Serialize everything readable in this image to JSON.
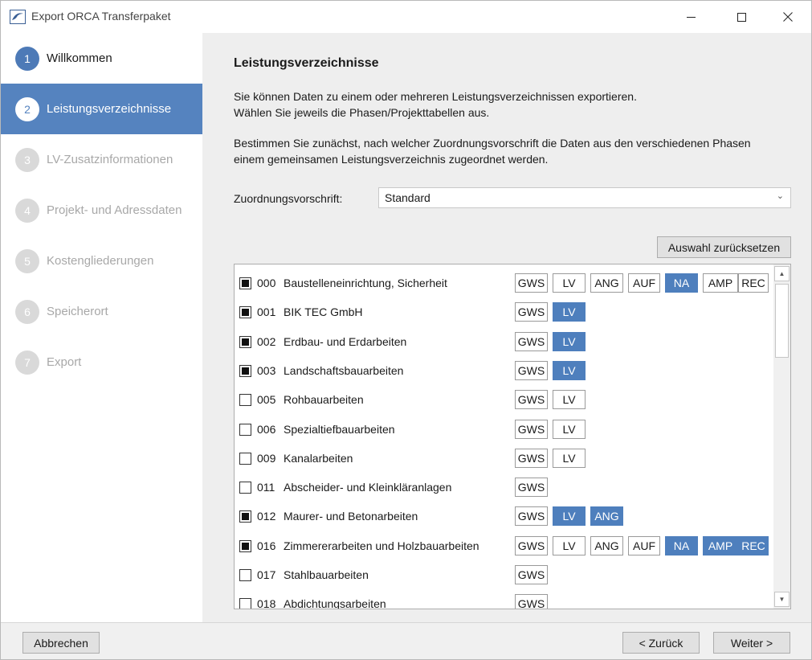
{
  "window": {
    "title": "Export ORCA Transferpaket",
    "icons": [
      "app-logo-icon",
      "minimize-icon",
      "maximize-icon",
      "close-icon"
    ]
  },
  "sidebar": {
    "steps": [
      {
        "num": "1",
        "label": "Willkommen",
        "state": "done"
      },
      {
        "num": "2",
        "label": "Leistungsverzeichnisse",
        "state": "active"
      },
      {
        "num": "3",
        "label": "LV-Zusatzinformationen",
        "state": "todo"
      },
      {
        "num": "4",
        "label": "Projekt- und Adressdaten",
        "state": "todo"
      },
      {
        "num": "5",
        "label": "Kostengliederungen",
        "state": "todo"
      },
      {
        "num": "6",
        "label": "Speicherort",
        "state": "todo"
      },
      {
        "num": "7",
        "label": "Export",
        "state": "todo"
      }
    ]
  },
  "main": {
    "heading": "Leistungsverzeichnisse",
    "intro_line1": "Sie können Daten zu einem oder mehreren Leistungsverzeichnissen exportieren.",
    "intro_line2": "Wählen Sie jeweils die Phasen/Projekttabellen aus.",
    "rule_line1": "Bestimmen Sie zunächst, nach welcher Zuordnungsvorschrift die Daten aus den verschiedenen Phasen",
    "rule_line2": "einem gemeinsamen Leistungsverzeichnis zugeordnet werden.",
    "zuordnung_label": "Zuordnungsvorschrift:",
    "zuordnung_value": "Standard",
    "reset_label": "Auswahl zurücksetzen"
  },
  "lv_list": [
    {
      "code": "000",
      "name": "Baustelleneinrichtung, Sicherheit",
      "checked": true,
      "phases": [
        {
          "label": "GWS",
          "selected": false
        },
        {
          "label": "LV",
          "selected": false
        },
        {
          "label": "ANG",
          "selected": false
        },
        {
          "label": "AUF",
          "selected": false
        },
        {
          "label": "NA",
          "selected": true
        },
        {
          "label": "AMP",
          "selected": false
        },
        {
          "label": "REC",
          "selected": false
        }
      ]
    },
    {
      "code": "001",
      "name": "BIK TEC GmbH",
      "checked": true,
      "phases": [
        {
          "label": "GWS",
          "selected": false
        },
        {
          "label": "LV",
          "selected": true
        }
      ]
    },
    {
      "code": "002",
      "name": "Erdbau- und Erdarbeiten",
      "checked": true,
      "phases": [
        {
          "label": "GWS",
          "selected": false
        },
        {
          "label": "LV",
          "selected": true
        }
      ]
    },
    {
      "code": "003",
      "name": "Landschaftsbauarbeiten",
      "checked": true,
      "phases": [
        {
          "label": "GWS",
          "selected": false
        },
        {
          "label": "LV",
          "selected": true
        }
      ]
    },
    {
      "code": "005",
      "name": "Rohbauarbeiten",
      "checked": false,
      "phases": [
        {
          "label": "GWS",
          "selected": false
        },
        {
          "label": "LV",
          "selected": false
        }
      ]
    },
    {
      "code": "006",
      "name": "Spezialtiefbauarbeiten",
      "checked": false,
      "phases": [
        {
          "label": "GWS",
          "selected": false
        },
        {
          "label": "LV",
          "selected": false
        }
      ]
    },
    {
      "code": "009",
      "name": "Kanalarbeiten",
      "checked": false,
      "phases": [
        {
          "label": "GWS",
          "selected": false
        },
        {
          "label": "LV",
          "selected": false
        }
      ]
    },
    {
      "code": "011",
      "name": "Abscheider- und Kleinkläranlagen",
      "checked": false,
      "phases": [
        {
          "label": "GWS",
          "selected": false
        }
      ]
    },
    {
      "code": "012",
      "name": "Maurer- und Betonarbeiten",
      "checked": true,
      "phases": [
        {
          "label": "GWS",
          "selected": false
        },
        {
          "label": "LV",
          "selected": true
        },
        {
          "label": "ANG",
          "selected": true
        }
      ]
    },
    {
      "code": "016",
      "name": "Zimmererarbeiten und Holzbauarbeiten",
      "checked": true,
      "phases": [
        {
          "label": "GWS",
          "selected": false
        },
        {
          "label": "LV",
          "selected": false
        },
        {
          "label": "ANG",
          "selected": false
        },
        {
          "label": "AUF",
          "selected": false
        },
        {
          "label": "NA",
          "selected": true
        },
        {
          "label": "AMP",
          "selected": true
        },
        {
          "label": "REC",
          "selected": true
        }
      ]
    },
    {
      "code": "017",
      "name": "Stahlbauarbeiten",
      "checked": false,
      "phases": [
        {
          "label": "GWS",
          "selected": false
        }
      ]
    },
    {
      "code": "018",
      "name": "Abdichtungsarbeiten",
      "checked": false,
      "phases": [
        {
          "label": "GWS",
          "selected": false
        }
      ]
    }
  ],
  "footer": {
    "cancel": "Abbrechen",
    "back": "< Zurück",
    "next": "Weiter >"
  },
  "colors": {
    "accent": "#5583bf",
    "phase_selected": "#4e7fbd",
    "content_bg": "#eeeeee"
  }
}
